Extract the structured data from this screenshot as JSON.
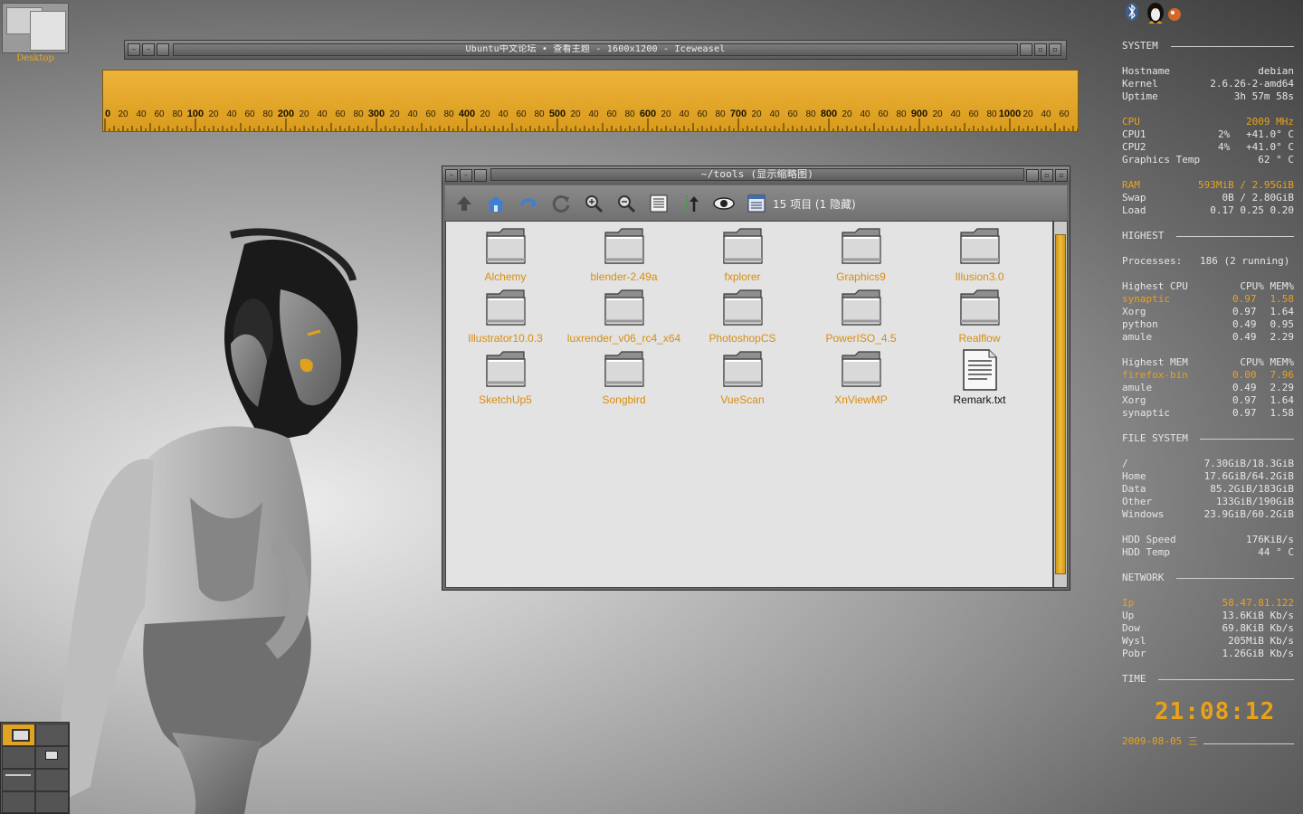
{
  "desktop": {
    "label": "Desktop"
  },
  "browser_window": {
    "title": "Ubuntu中文论坛 • 查看主题 - 1600x1200 - Iceweasel"
  },
  "ruler": {
    "major_labels": [
      "0",
      "100",
      "200",
      "300",
      "400",
      "500",
      "600",
      "700",
      "800",
      "900",
      "1000"
    ],
    "minor_labels": [
      "20",
      "40",
      "60",
      "80"
    ],
    "tail_labels": [
      "20",
      "40",
      "60"
    ]
  },
  "file_manager": {
    "title": "~/tools (显示缩略图)",
    "status": "15 项目 (1 隐藏)",
    "toolbar": [
      "up-icon",
      "home-icon",
      "back-icon",
      "reload-icon",
      "zoom-in-icon",
      "zoom-out-icon",
      "list-view-icon",
      "sort-icon",
      "show-hidden-icon",
      "details-view-icon"
    ],
    "files": [
      {
        "name": "Alchemy",
        "type": "folder"
      },
      {
        "name": "blender-2.49a",
        "type": "folder"
      },
      {
        "name": "fxplorer",
        "type": "folder"
      },
      {
        "name": "Graphics9",
        "type": "folder"
      },
      {
        "name": "Illusion3.0",
        "type": "folder"
      },
      {
        "name": "Illustrator10.0.3",
        "type": "folder"
      },
      {
        "name": "luxrender_v06_rc4_x64",
        "type": "folder"
      },
      {
        "name": "PhotoshopCS",
        "type": "folder"
      },
      {
        "name": "PowerISO_4.5",
        "type": "folder"
      },
      {
        "name": "Realflow",
        "type": "folder"
      },
      {
        "name": "SketchUp5",
        "type": "folder"
      },
      {
        "name": "Songbird",
        "type": "folder"
      },
      {
        "name": "VueScan",
        "type": "folder"
      },
      {
        "name": "XnViewMP",
        "type": "folder"
      },
      {
        "name": "Remark.txt",
        "type": "text"
      }
    ]
  },
  "conky": {
    "system": {
      "title": "SYSTEM",
      "hostname_label": "Hostname",
      "hostname": "debian",
      "kernel_label": "Kernel",
      "kernel": "2.6.26-2-amd64",
      "uptime_label": "Uptime",
      "uptime": "3h 57m 58s",
      "cpu_label": "CPU",
      "cpu_freq": "2009 MHz",
      "cpu1_label": "CPU1",
      "cpu1_usage": "2%",
      "cpu1_temp": "+41.0° C",
      "cpu2_label": "CPU2",
      "cpu2_usage": "4%",
      "cpu2_temp": "+41.0° C",
      "gpu_temp_label": "Graphics Temp",
      "gpu_temp": "62 ° C",
      "ram_label": "RAM",
      "ram": "593MiB / 2.95GiB",
      "swap_label": "Swap",
      "swap": "0B   / 2.80GiB",
      "load_label": "Load",
      "load": "0.17 0.25 0.20"
    },
    "highest": {
      "title": "HIGHEST",
      "processes_label": "Processes:",
      "processes": "186 (2 running)",
      "cpu_header": "Highest CPU",
      "cpu_cols": "CPU% MEM%",
      "cpu_rows": [
        {
          "name": "synaptic",
          "cpu": "0.97",
          "mem": "1.58",
          "hl": true
        },
        {
          "name": "Xorg",
          "cpu": "0.97",
          "mem": "1.64"
        },
        {
          "name": "python",
          "cpu": "0.49",
          "mem": "0.95"
        },
        {
          "name": "amule",
          "cpu": "0.49",
          "mem": "2.29"
        }
      ],
      "mem_header": "Highest MEM",
      "mem_cols": "CPU% MEM%",
      "mem_rows": [
        {
          "name": "firefox-bin",
          "cpu": "0.00",
          "mem": "7.96",
          "hl": true
        },
        {
          "name": "amule",
          "cpu": "0.49",
          "mem": "2.29"
        },
        {
          "name": "Xorg",
          "cpu": "0.97",
          "mem": "1.64"
        },
        {
          "name": "synaptic",
          "cpu": "0.97",
          "mem": "1.58"
        }
      ]
    },
    "filesystem": {
      "title": "FILE SYSTEM",
      "rows": [
        {
          "name": "/",
          "value": "7.30GiB/18.3GiB"
        },
        {
          "name": "Home",
          "value": "17.6GiB/64.2GiB"
        },
        {
          "name": "Data",
          "value": "85.2GiB/183GiB"
        },
        {
          "name": "Other",
          "value": "133GiB/190GiB"
        },
        {
          "name": "Windows",
          "value": "23.9GiB/60.2GiB"
        }
      ],
      "hdd_speed_label": "HDD Speed",
      "hdd_speed": "176KiB/s",
      "hdd_temp_label": "HDD Temp",
      "hdd_temp": "44 ° C"
    },
    "network": {
      "title": "NETWORK",
      "ip_label": "Ip",
      "ip": "58.47.81.122",
      "up_label": "Up",
      "up": "13.6KiB Kb/s",
      "down_label": "Dow",
      "down": "69.8KiB Kb/s",
      "wysl_label": "Wysl",
      "wysl": "205MiB Kb/s",
      "pobr_label": "Pobr",
      "pobr": "1.26GiB Kb/s"
    },
    "time": {
      "title": "TIME",
      "clock": "21:08:12",
      "date": "2009-08-05 三"
    }
  },
  "colors": {
    "accent": "#e8a21a",
    "ruler": "#e3a62a",
    "file_label": "#d98d10",
    "panel_bg": "#6a6a6a"
  }
}
